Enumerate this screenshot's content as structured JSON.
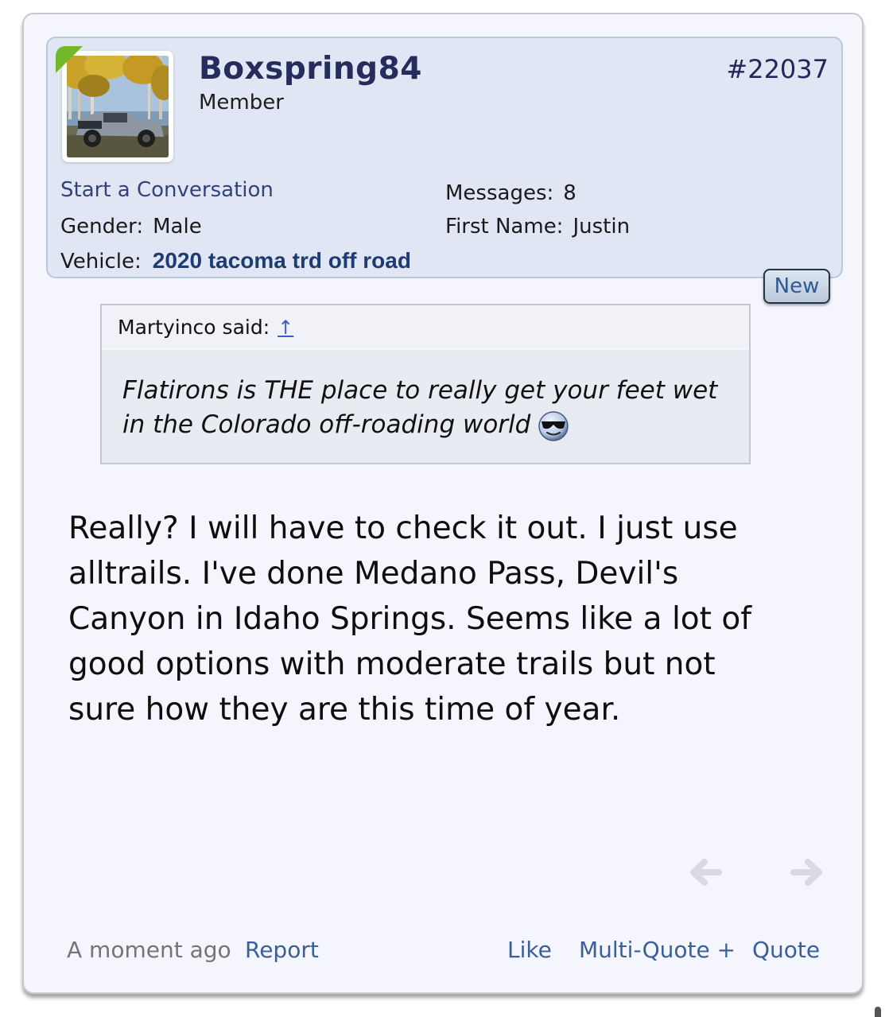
{
  "post": {
    "number": "#22037",
    "user": {
      "name": "Boxspring84",
      "title": "Member",
      "start_conversation": "Start a Conversation",
      "messages_label": "Messages:",
      "messages_value": "8",
      "gender_label": "Gender:",
      "gender_value": "Male",
      "first_name_label": "First Name:",
      "first_name_value": "Justin",
      "vehicle_label": "Vehicle:",
      "vehicle_value": "2020 tacoma trd off road"
    },
    "new_badge": "New",
    "quote": {
      "author": "Martyinco said:",
      "jump_icon": "↑",
      "text": "Flatirons is THE place to really get your feet wet in the Colorado off-roading world"
    },
    "body": "Really? I will have to check it out. I just use alltrails. I've done Medano Pass, Devil's Canyon in Idaho Springs. Seems like a lot of good options with moderate trails but not sure how they are this time of year.",
    "footer": {
      "time": "A moment ago",
      "report": "Report",
      "like": "Like",
      "multi_quote": "Multi-Quote +",
      "quote": "Quote"
    }
  },
  "icons": {
    "prev": "arrow-left-icon",
    "next": "arrow-right-icon",
    "smiley": "cool-smiley-icon"
  },
  "colors": {
    "username": "#262d5c",
    "link": "#3a5f99",
    "card_bg": "#f4f5fd",
    "header_bg": "#e0e6f3",
    "online": "#72b82a"
  }
}
